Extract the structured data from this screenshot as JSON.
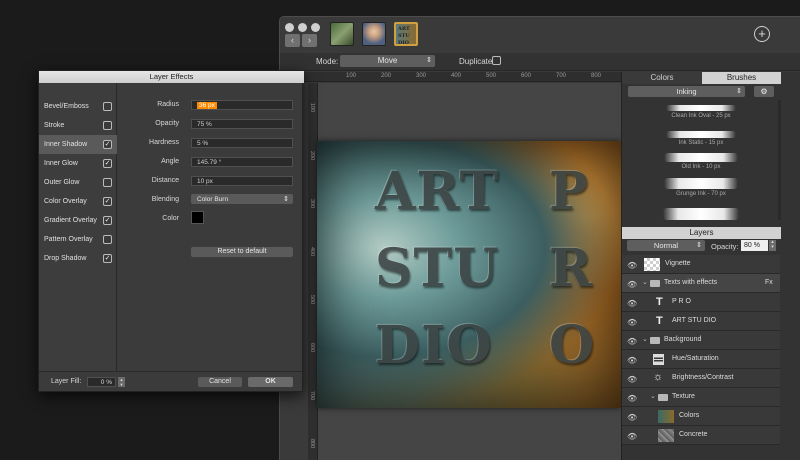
{
  "window": {
    "title": "",
    "mode_label": "Mode:",
    "mode_value": "Move",
    "duplicate_label": "Duplicate",
    "add_symbol": "+",
    "nav_back": "‹",
    "nav_forward": "›",
    "thumb3_text": "ART STU DIO"
  },
  "ruler": {
    "ticks": [
      "100",
      "200",
      "300",
      "400",
      "500",
      "600",
      "700",
      "800"
    ]
  },
  "ruler_left": {
    "ticks": [
      "100",
      "200",
      "300",
      "400",
      "500",
      "600",
      "700",
      "800"
    ]
  },
  "art": {
    "line1": "ART",
    "line2": "STU",
    "line3": "DIO",
    "c1": "P",
    "c2": "R",
    "c3": "O"
  },
  "panel": {
    "tab_colors": "Colors",
    "tab_brushes": "Brushes",
    "brush_category": "Inking",
    "settings_icon": "⚙",
    "brushes": [
      "Clean Ink Oval - 25 px",
      "Ink Static - 15 px",
      "Old Ink - 10 px",
      "Grunge Ink - 70 px",
      ""
    ],
    "layers_title": "Layers",
    "blend_mode": "Normal",
    "opacity_label": "Opacity:",
    "opacity_value": "80 %",
    "layers": [
      {
        "name": "Vignette",
        "icon": "checker-icon"
      },
      {
        "name": "Texts with effects",
        "icon": "folder-icon",
        "fx": "Fx",
        "disclosure": "⌄"
      },
      {
        "name": "P R O",
        "icon": "text-icon",
        "glyph": "T"
      },
      {
        "name": "ART STU DIO",
        "icon": "text-icon",
        "glyph": "T"
      },
      {
        "name": "Background",
        "icon": "folder-icon",
        "disclosure": "⌄"
      },
      {
        "name": "Hue/Saturation",
        "icon": "adjustment-icon"
      },
      {
        "name": "Brightness/Contrast",
        "icon": "sun-icon",
        "glyph": "☼"
      },
      {
        "name": "Texture",
        "icon": "folder-icon",
        "disclosure": "⌄"
      },
      {
        "name": "Colors",
        "icon": "image-icon"
      },
      {
        "name": "Concrete",
        "icon": "image-icon"
      }
    ],
    "eye": "👁"
  },
  "dialog": {
    "title": "Layer Effects",
    "effects": [
      {
        "label": "Bevel/Emboss",
        "checked": false
      },
      {
        "label": "Stroke",
        "checked": false
      },
      {
        "label": "Inner Shadow",
        "checked": true
      },
      {
        "label": "Inner Glow",
        "checked": true
      },
      {
        "label": "Outer Glow",
        "checked": false
      },
      {
        "label": "Color Overlay",
        "checked": true
      },
      {
        "label": "Gradient Overlay",
        "checked": true
      },
      {
        "label": "Pattern Overlay",
        "checked": false
      },
      {
        "label": "Drop Shadow",
        "checked": true
      }
    ],
    "check": "✓",
    "params": {
      "radius_label": "Radius",
      "radius_value": "36 px",
      "opacity_label": "Opacity",
      "opacity_value": "75 %",
      "hardness_label": "Hardness",
      "hardness_value": "5 %",
      "angle_label": "Angle",
      "angle_value": "145.79 °",
      "distance_label": "Distance",
      "distance_value": "10 px",
      "blending_label": "Blending",
      "blending_value": "Color Burn",
      "color_label": "Color",
      "color_swatch": "#000000"
    },
    "reset_label": "Reset to default",
    "layer_fill_label": "Layer Fill:",
    "layer_fill_value": "0 %",
    "cancel_label": "Cancel",
    "ok_label": "OK"
  },
  "colors": {
    "highlight": "#ff8a00",
    "ok": "#6a6a6a"
  }
}
